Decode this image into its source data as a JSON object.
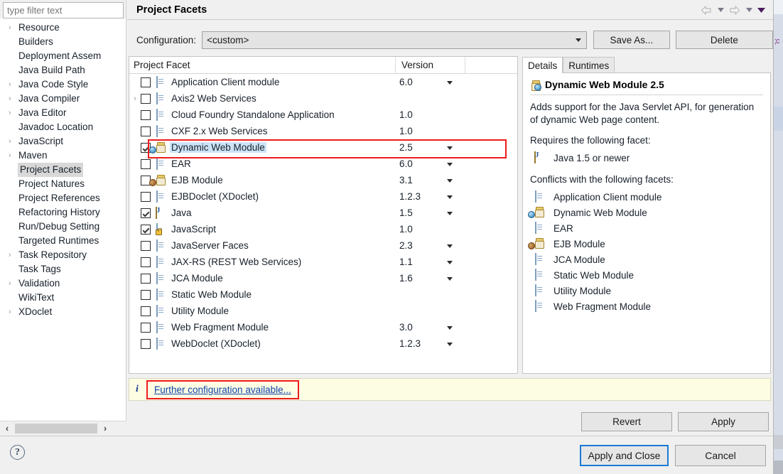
{
  "window": {
    "title": "Project Facets"
  },
  "sidebar": {
    "filter_placeholder": "type filter text",
    "filter_value": "",
    "items": [
      {
        "label": "Resource",
        "expandable": true,
        "selected": false
      },
      {
        "label": "Builders",
        "expandable": false,
        "selected": false
      },
      {
        "label": "Deployment Assem",
        "expandable": false,
        "selected": false
      },
      {
        "label": "Java Build Path",
        "expandable": false,
        "selected": false
      },
      {
        "label": "Java Code Style",
        "expandable": true,
        "selected": false
      },
      {
        "label": "Java Compiler",
        "expandable": true,
        "selected": false
      },
      {
        "label": "Java Editor",
        "expandable": true,
        "selected": false
      },
      {
        "label": "Javadoc Location",
        "expandable": false,
        "selected": false
      },
      {
        "label": "JavaScript",
        "expandable": true,
        "selected": false
      },
      {
        "label": "Maven",
        "expandable": true,
        "selected": false
      },
      {
        "label": "Project Facets",
        "expandable": false,
        "selected": true
      },
      {
        "label": "Project Natures",
        "expandable": false,
        "selected": false
      },
      {
        "label": "Project References",
        "expandable": false,
        "selected": false
      },
      {
        "label": "Refactoring History",
        "expandable": false,
        "selected": false
      },
      {
        "label": "Run/Debug Setting",
        "expandable": false,
        "selected": false
      },
      {
        "label": "Targeted Runtimes",
        "expandable": false,
        "selected": false
      },
      {
        "label": "Task Repository",
        "expandable": true,
        "selected": false
      },
      {
        "label": "Task Tags",
        "expandable": false,
        "selected": false
      },
      {
        "label": "Validation",
        "expandable": true,
        "selected": false
      },
      {
        "label": "WikiText",
        "expandable": false,
        "selected": false
      },
      {
        "label": "XDoclet",
        "expandable": true,
        "selected": false
      }
    ],
    "scroll_left_icon": "‹",
    "scroll_right_icon": "›"
  },
  "nav": {
    "back_icon": "back-arrow-icon",
    "forward_icon": "forward-arrow-icon",
    "menu_icon": "dropdown-caret-icon"
  },
  "config": {
    "label": "Configuration:",
    "value": "<custom>",
    "save_as_label": "Save As...",
    "delete_label": "Delete"
  },
  "table": {
    "columns": [
      "Project Facet",
      "Version"
    ],
    "rows": [
      {
        "name": "Application Client module",
        "version": "6.0",
        "checked": false,
        "expandable": false,
        "has_version_caret": true,
        "icon": "doc",
        "selected": false
      },
      {
        "name": "Axis2 Web Services",
        "version": "",
        "checked": false,
        "expandable": true,
        "has_version_caret": false,
        "icon": "doc",
        "selected": false
      },
      {
        "name": "Cloud Foundry Standalone Application",
        "version": "1.0",
        "checked": false,
        "expandable": false,
        "has_version_caret": false,
        "icon": "doc",
        "selected": false
      },
      {
        "name": "CXF 2.x Web Services",
        "version": "1.0",
        "checked": false,
        "expandable": false,
        "has_version_caret": false,
        "icon": "doc",
        "selected": false
      },
      {
        "name": "Dynamic Web Module",
        "version": "2.5",
        "checked": true,
        "expandable": false,
        "has_version_caret": true,
        "icon": "jar-globe",
        "selected": true
      },
      {
        "name": "EAR",
        "version": "6.0",
        "checked": false,
        "expandable": false,
        "has_version_caret": true,
        "icon": "doc",
        "selected": false
      },
      {
        "name": "EJB Module",
        "version": "3.1",
        "checked": false,
        "expandable": false,
        "has_version_caret": true,
        "icon": "jar-bean",
        "selected": false
      },
      {
        "name": "EJBDoclet (XDoclet)",
        "version": "1.2.3",
        "checked": false,
        "expandable": false,
        "has_version_caret": true,
        "icon": "doc",
        "selected": false
      },
      {
        "name": "Java",
        "version": "1.5",
        "checked": true,
        "expandable": false,
        "has_version_caret": true,
        "icon": "java",
        "selected": false
      },
      {
        "name": "JavaScript",
        "version": "1.0",
        "checked": true,
        "expandable": false,
        "has_version_caret": false,
        "icon": "js-lock",
        "selected": false
      },
      {
        "name": "JavaServer Faces",
        "version": "2.3",
        "checked": false,
        "expandable": false,
        "has_version_caret": true,
        "icon": "doc",
        "selected": false
      },
      {
        "name": "JAX-RS (REST Web Services)",
        "version": "1.1",
        "checked": false,
        "expandable": false,
        "has_version_caret": true,
        "icon": "doc",
        "selected": false
      },
      {
        "name": "JCA Module",
        "version": "1.6",
        "checked": false,
        "expandable": false,
        "has_version_caret": true,
        "icon": "doc",
        "selected": false
      },
      {
        "name": "Static Web Module",
        "version": "",
        "checked": false,
        "expandable": false,
        "has_version_caret": false,
        "icon": "doc",
        "selected": false
      },
      {
        "name": "Utility Module",
        "version": "",
        "checked": false,
        "expandable": false,
        "has_version_caret": false,
        "icon": "doc",
        "selected": false
      },
      {
        "name": "Web Fragment Module",
        "version": "3.0",
        "checked": false,
        "expandable": false,
        "has_version_caret": true,
        "icon": "doc",
        "selected": false
      },
      {
        "name": "WebDoclet (XDoclet)",
        "version": "1.2.3",
        "checked": false,
        "expandable": false,
        "has_version_caret": true,
        "icon": "doc",
        "selected": false
      }
    ]
  },
  "details": {
    "tabs": [
      {
        "label": "Details",
        "active": true
      },
      {
        "label": "Runtimes",
        "active": false
      }
    ],
    "heading": "Dynamic Web Module 2.5",
    "heading_icon": "jar-globe",
    "description": "Adds support for the Java Servlet API, for generation of dynamic Web page content.",
    "requires_title": "Requires the following facet:",
    "requires": [
      {
        "label": "Java 1.5 or newer",
        "icon": "java"
      }
    ],
    "conflicts_title": "Conflicts with the following facets:",
    "conflicts": [
      {
        "label": "Application Client module",
        "icon": "doc"
      },
      {
        "label": "Dynamic Web Module",
        "icon": "jar-globe"
      },
      {
        "label": "EAR",
        "icon": "doc"
      },
      {
        "label": "EJB Module",
        "icon": "jar-bean"
      },
      {
        "label": "JCA Module",
        "icon": "doc"
      },
      {
        "label": "Static Web Module",
        "icon": "doc"
      },
      {
        "label": "Utility Module",
        "icon": "doc"
      },
      {
        "label": "Web Fragment Module",
        "icon": "doc"
      }
    ]
  },
  "info_bar": {
    "icon": "info-icon",
    "icon_glyph": "i",
    "link_text": "Further configuration available..."
  },
  "actions": {
    "revert_label": "Revert",
    "apply_label": "Apply",
    "apply_and_close_label": "Apply and Close",
    "cancel_label": "Cancel",
    "help_glyph": "?"
  },
  "colors": {
    "selection_blue": "#cde4f7",
    "annotation_red": "#ee1c1c",
    "focus_blue": "#1a7bd4",
    "info_yellow": "#fdfde4",
    "link_blue": "#1144aa"
  }
}
